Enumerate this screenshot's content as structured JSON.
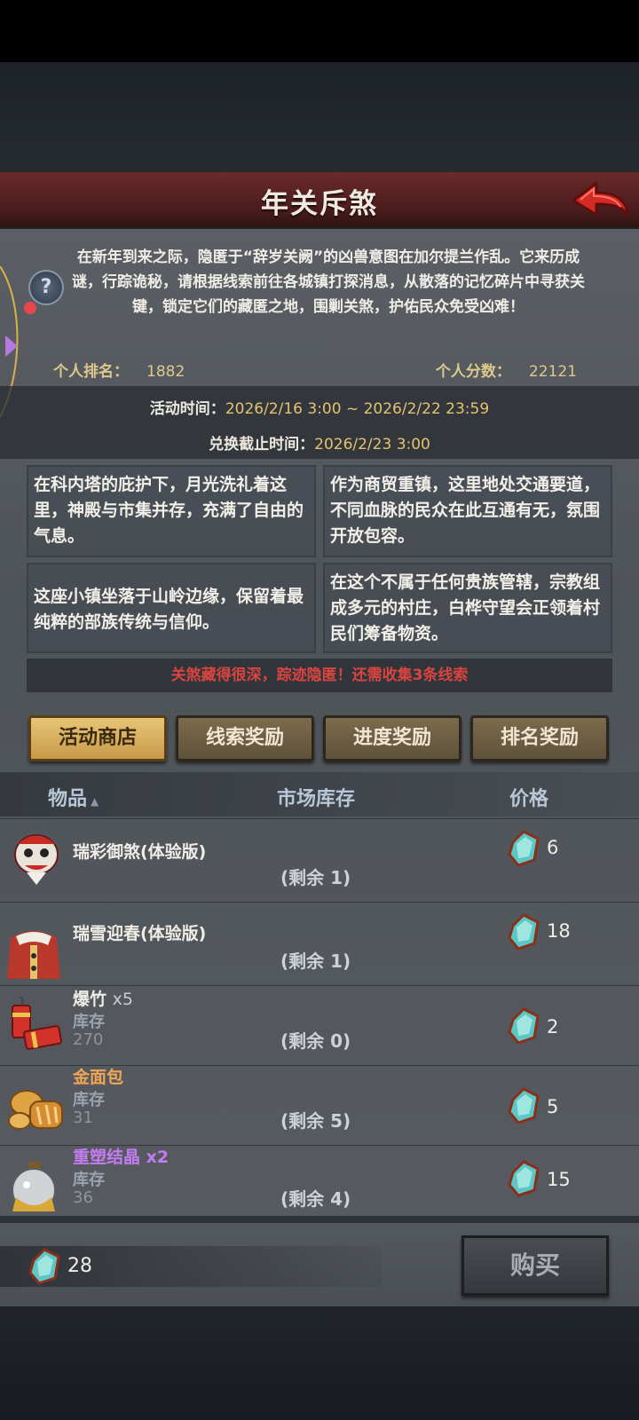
{
  "header": {
    "title": "年关斥煞"
  },
  "intro": {
    "text": "在新年到来之际，隐匿于“辞岁关阙”的凶兽意图在加尔提兰作乱。它来历成谜，行踪诡秘，请根据线索前往各城镇打探消息，从散落的记忆碎片中寻获关键，锁定它们的藏匿之地，围剿关煞，护佑民众免受凶难！"
  },
  "stats": {
    "rank_label": "个人排名：",
    "rank_value": "1882",
    "score_label": "个人分数：",
    "score_value": "22121"
  },
  "event_time": {
    "label": "活动时间：",
    "value": "2026/2/16 3:00 ~ 2026/2/22 23:59",
    "exchange_label": "兑换截止时间：",
    "exchange_value": "2026/2/23 3:00"
  },
  "clues": [
    "在科内塔的庇护下，月光洗礼着这里，神殿与市集并存，充满了自由的气息。",
    "作为商贸重镇，这里地处交通要道，不同血脉的民众在此互通有无，氛围开放包容。",
    "这座小镇坐落于山岭边缘，保留着最纯粹的部族传统与信仰。",
    "在这个不属于任何贵族管辖，宗教组成多元的村庄，白桦守望会正领着村民们筹备物资。"
  ],
  "alert": "关煞藏得很深，踪迹隐匿！还需收集3条线索",
  "tabs": [
    "活动商店",
    "线索奖励",
    "进度奖励",
    "排名奖励"
  ],
  "table": {
    "col_item": "物品",
    "col_stock": "市场库存",
    "col_price": "价格",
    "rows": [
      {
        "name": "瑞彩御煞(体验版)",
        "qty": "",
        "stock_label": "",
        "stock": "",
        "remain": "(剩余 1)",
        "price": "6"
      },
      {
        "name": "瑞雪迎春(体验版)",
        "qty": "",
        "stock_label": "",
        "stock": "",
        "remain": "(剩余 1)",
        "price": "18"
      },
      {
        "name": "爆竹",
        "qty": "x5",
        "stock_label": "库存",
        "stock": "270",
        "remain": "(剩余 0)",
        "price": "2"
      },
      {
        "name": "金面包",
        "qty": "",
        "stock_label": "库存",
        "stock": "31",
        "remain": "(剩余 5)",
        "price": "5"
      },
      {
        "name": "重塑结晶",
        "qty": "x2",
        "stock_label": "库存",
        "stock": "36",
        "remain": "(剩余 4)",
        "price": "15"
      }
    ]
  },
  "footer": {
    "balance": "28",
    "buy_label": "购买"
  },
  "colors": {
    "accent_gold": "#e2c46f",
    "alert_red": "#d9453e",
    "title_red": "#6b2a2a"
  }
}
